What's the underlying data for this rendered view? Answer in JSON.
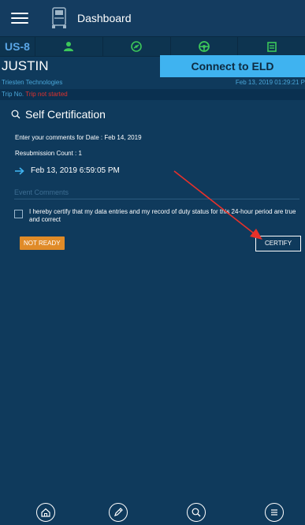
{
  "header": {
    "title": "Dashboard",
    "menu_icon": "hamburger-menu-icon",
    "logo_icon": "truck-logo-icon"
  },
  "status_bar": {
    "rule_set": "US-8",
    "statuses": [
      {
        "icon": "off-duty-icon"
      },
      {
        "icon": "sleeper-berth-icon"
      },
      {
        "icon": "driving-steering-icon"
      },
      {
        "icon": "on-duty-icon"
      }
    ]
  },
  "driver": {
    "name": "JUSTIN",
    "company": "Triesten Technologies",
    "connect_eld_label": "Connect to ELD",
    "datetime": "Feb 13, 2019 01:29:21 P"
  },
  "trip": {
    "label": "Trip No.",
    "value": "Trip not started"
  },
  "self_certification": {
    "title": "Self Certification",
    "title_icon": "search-icon",
    "comment_date_text": "Enter your comments for Date : Feb 14, 2019",
    "resubmission_text": "Resubmission Count : 1",
    "event_time": "Feb 13, 2019 6:59:05 PM",
    "event_comments_placeholder": "Event Comments",
    "certify_text": "I hereby certify that my data entries and my record of duty status for this 24-hour period are true and correct",
    "not_ready_label": "NOT READY",
    "certify_label": "CERTIFY"
  },
  "bottom_nav": [
    {
      "icon": "home-icon"
    },
    {
      "icon": "edit-pencil-icon"
    },
    {
      "icon": "search-icon"
    },
    {
      "icon": "list-menu-icon"
    }
  ],
  "colors": {
    "background": "#0f3a5c",
    "accent_blue": "#3fb3f0",
    "status_green": "#3cc75a",
    "alert_red": "#e0322d",
    "not_ready_orange": "#e08b28",
    "annotation_arrow": "#e8312a"
  }
}
